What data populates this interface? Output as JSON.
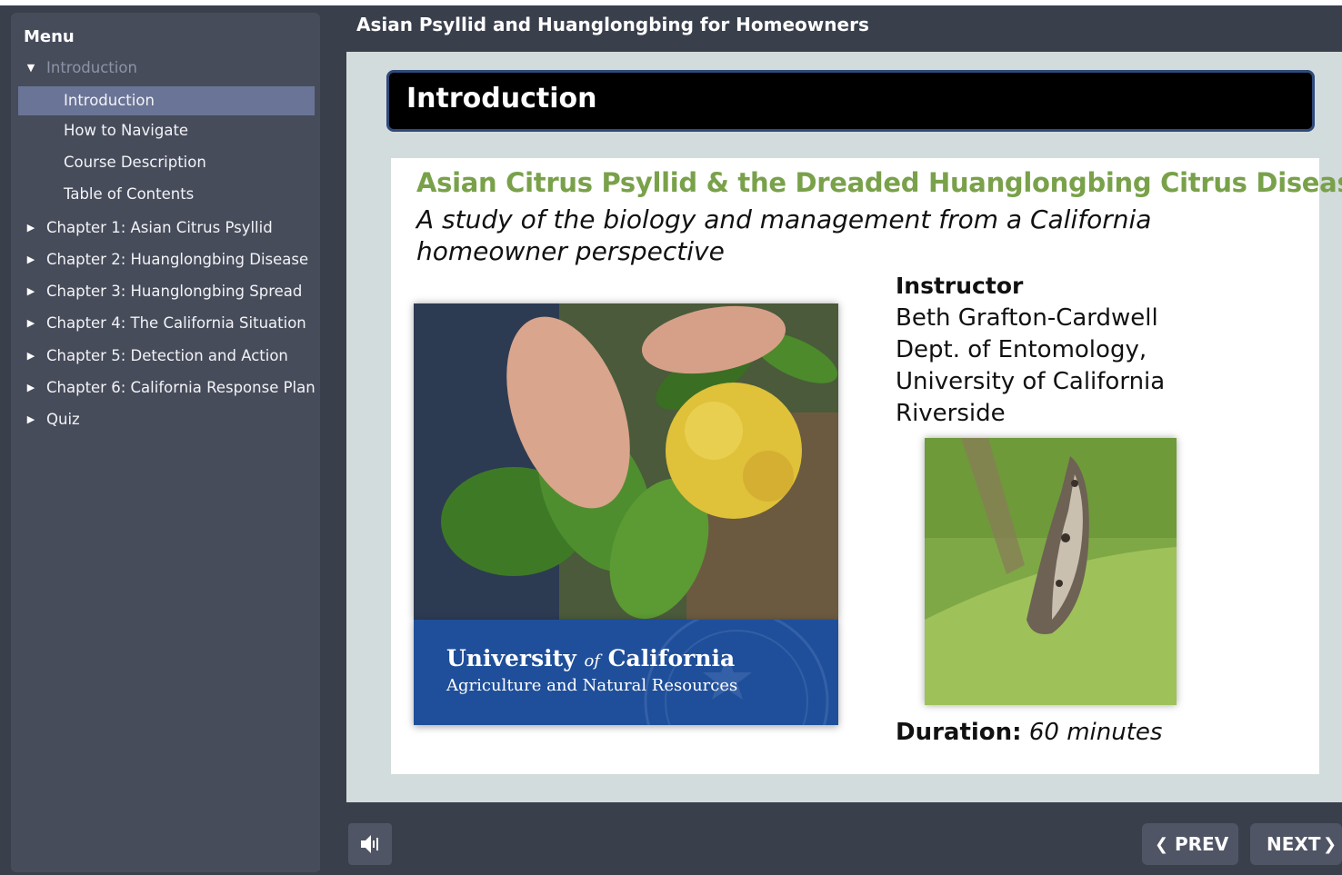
{
  "app": {
    "title": "Asian Psyllid and Huanglongbing for Homeowners"
  },
  "sidebar": {
    "tab_label": "Menu",
    "items": [
      {
        "label": "Introduction",
        "kind": "section",
        "caret": "▼"
      },
      {
        "label": "Introduction",
        "kind": "sub",
        "selected": true
      },
      {
        "label": "How to Navigate",
        "kind": "sub"
      },
      {
        "label": "Course Description",
        "kind": "sub"
      },
      {
        "label": "Table of Contents",
        "kind": "sub"
      },
      {
        "label": "Chapter 1: Asian Citrus Psyllid",
        "kind": "chapter",
        "caret": "▶"
      },
      {
        "label": "Chapter 2: Huanglongbing Disease",
        "kind": "chapter",
        "caret": "▶"
      },
      {
        "label": "Chapter 3: Huanglongbing Spread",
        "kind": "chapter",
        "caret": "▶"
      },
      {
        "label": "Chapter 4: The California Situation",
        "kind": "chapter",
        "caret": "▶"
      },
      {
        "label": "Chapter 5: Detection and Action",
        "kind": "chapter",
        "caret": "▶"
      },
      {
        "label": "Chapter 6: California Response Plan",
        "kind": "chapter",
        "caret": "▶"
      },
      {
        "label": "Quiz",
        "kind": "chapter",
        "caret": "▶"
      }
    ]
  },
  "slide": {
    "title": "Introduction",
    "heading": "Asian Citrus Psyllid & the Dreaded Huanglongbing Citrus Disease",
    "subheading": "A study of the biology and management from a California homeowner perspective",
    "instructor_label": "Instructor",
    "instructor_lines": [
      "Beth Grafton-Cardwell",
      "Dept. of Entomology,",
      "University of California",
      "Riverside"
    ],
    "duration_label": "Duration:",
    "duration_value": "60 minutes",
    "logo": {
      "name_part1": "University ",
      "name_part2": "of",
      "name_part3": " California",
      "unit": "Agriculture and Natural Resources"
    }
  },
  "toolbar": {
    "prev_label": "PREV",
    "next_label": "NEXT",
    "prev_icon": "chevron-left-icon",
    "next_icon": "chevron-right-icon",
    "sound_icon": "speaker-icon"
  },
  "colors": {
    "sidebar_bg": "#474c5b",
    "selected_bg": "#6a7496",
    "heading_green": "#79a14a",
    "logo_blue": "#1f4f9a"
  }
}
